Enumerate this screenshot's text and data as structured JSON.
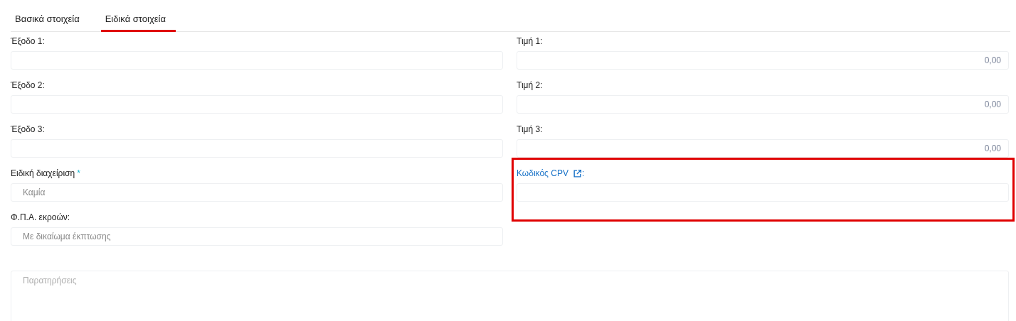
{
  "tabs": [
    {
      "label": "Βασικά στοιχεία",
      "selected": false
    },
    {
      "label": "Ειδικά στοιχεία",
      "selected": true
    }
  ],
  "fields": [
    {
      "kind": "text",
      "label": "Έξοδο 1:"
    },
    {
      "kind": "amount",
      "label": "Τιμή 1:",
      "value": "0,00"
    },
    {
      "kind": "text",
      "label": "Έξοδο 2:"
    },
    {
      "kind": "amount",
      "label": "Τιμή 2:",
      "value": "0,00"
    },
    {
      "kind": "text",
      "label": "Έξοδο 3:"
    },
    {
      "kind": "amount",
      "label": "Τιμή 3:",
      "value": "0,00"
    },
    {
      "kind": "select",
      "label": "Ειδική διαχείριση",
      "required_mark": "*",
      "value": "Καμία"
    },
    {
      "kind": "link",
      "label": "Κωδικός CPV",
      "suffix": ":",
      "highlighted": true
    },
    {
      "kind": "select",
      "label": "Φ.Π.Α. εκροών:",
      "value": "Με δικαίωμα έκπτωσης"
    }
  ],
  "notes": {
    "placeholder": "Παρατηρήσεις"
  }
}
